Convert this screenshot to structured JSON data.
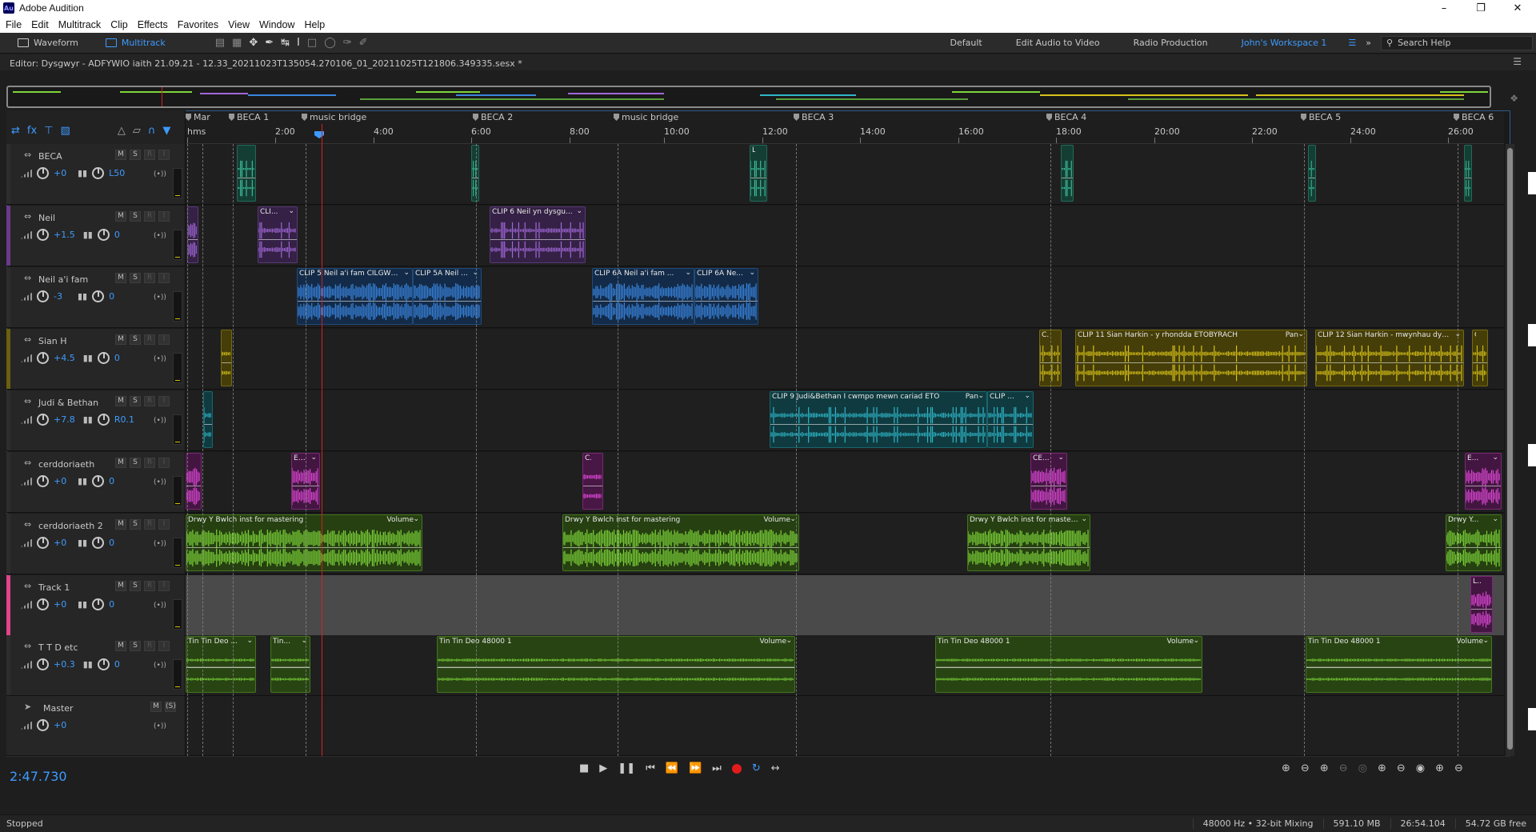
{
  "window": {
    "app_title": "Adobe Audition",
    "app_icon": "Au"
  },
  "menu": [
    "File",
    "Edit",
    "Multitrack",
    "Clip",
    "Effects",
    "Favorites",
    "View",
    "Window",
    "Help"
  ],
  "toolbar": {
    "waveform_label": "Waveform",
    "multitrack_label": "Multitrack",
    "workspaces": [
      "Default",
      "Edit Audio to Video",
      "Radio Production",
      "John's Workspace 1"
    ],
    "active_workspace": "John's Workspace 1",
    "search_placeholder": "Search Help"
  },
  "editor": {
    "title": "Editor: Dysgwyr - ADFYWIO iaith 21.09.21 - 12.33_20211023T135054.270106_01_20211025T121806.349335.sesx *"
  },
  "ruler": {
    "hms_label": "hms",
    "ticks": [
      "2:00",
      "4:00",
      "6:00",
      "8:00",
      "10:00",
      "12:00",
      "14:00",
      "16:00",
      "18:00",
      "20:00",
      "22:00",
      "24:00",
      "26:00"
    ]
  },
  "markers": [
    "Mar",
    "BECA 1",
    "music bridge",
    "BECA 2",
    "music bridge",
    "BECA 3",
    "BECA 4",
    "BECA 5",
    "BECA 6"
  ],
  "colors": {
    "accent": "#3d9bff",
    "teal": "#3fc2a0",
    "purple": "#a268d8",
    "blue": "#3a86e0",
    "yellow": "#d8c21a",
    "cyan": "#2fb7c8",
    "magenta": "#e048d8",
    "green": "#7ed63a",
    "record": "#e21b1b",
    "playhead": "#d61e1e"
  },
  "tracks": [
    {
      "name": "BECA",
      "volume": "+0",
      "pan": "L50"
    },
    {
      "name": "Neil",
      "volume": "+1.5",
      "pan": "0"
    },
    {
      "name": "Neil a'i fam",
      "volume": "-3",
      "pan": "0"
    },
    {
      "name": "Sian H",
      "volume": "+4.5",
      "pan": "0"
    },
    {
      "name": "Judi & Bethan",
      "volume": "+7.8",
      "pan": "R0.1"
    },
    {
      "name": "cerddoriaeth",
      "volume": "+0",
      "pan": "0"
    },
    {
      "name": "cerddoriaeth 2",
      "volume": "+0",
      "pan": "0"
    },
    {
      "name": "Track 1",
      "volume": "+0",
      "pan": "0"
    },
    {
      "name": "T T D etc",
      "volume": "+0.3",
      "pan": "0"
    }
  ],
  "master": {
    "name": "Master",
    "volume": "+0"
  },
  "track_buttons": {
    "mute": "M",
    "solo": "S",
    "arm": "R",
    "input": "I"
  },
  "clips": {
    "neil_1": "CLI...",
    "neil_2": "CLIP 6 Neil yn dysgu...",
    "neilfam_1": "CLIP 5 Neil a'i fam CILGWR...",
    "neilfam_2": "CLIP 5A Neil ...",
    "neilfam_3": "CLIP 6A Neil a'i fam ...",
    "neilfam_4": "CLIP 6A Ne...",
    "sian_1": "CLI...",
    "sian_2": "CLIP 11 Sian Harkin - y rhondda ETOBYRACH",
    "sian_2_tag": "Pan",
    "sian_3": "CLIP 12 Sian Harkin - mwynhau dys...",
    "sian_4": "C...",
    "judi_1": "CLIP 9 Judi&Bethan I cwmpo mewn cariad ETO",
    "judi_1_tag": "Pan",
    "judi_2": "CLIP ...",
    "cerdd_1": "EOS...",
    "cerdd_2": "CE...",
    "cerdd_3": "CE...",
    "cerdd_4": "E...",
    "cerdd2_1": "Drwy Y Bwlch inst for mastering",
    "cerdd2_1_tag": "Volume",
    "cerdd2_2": "Drwy Y Bwlch inst for mastering",
    "cerdd2_2_tag": "Volume",
    "cerdd2_3": "Drwy Y Bwlch inst for master...",
    "cerdd2_4": "Drwy Y...",
    "track1_1": "Lul...",
    "ttd_1": "Tin Tin Deo ...",
    "ttd_2": "Tin...",
    "ttd_3": "Tin Tin Deo 48000 1",
    "ttd_3_tag": "Volume",
    "ttd_4": "Tin Tin Deo 48000 1",
    "ttd_4_tag": "Volume",
    "ttd_5": "Tin Tin Deo 48000 1",
    "ttd_5_tag": "Volume",
    "beca_1": "Li..."
  },
  "transport": {
    "timecode": "2:47.730"
  },
  "status": {
    "state": "Stopped",
    "sample": "48000 Hz • 32-bit Mixing",
    "memory": "591.10 MB",
    "duration": "26:54.104",
    "disk": "54.72 GB free"
  }
}
